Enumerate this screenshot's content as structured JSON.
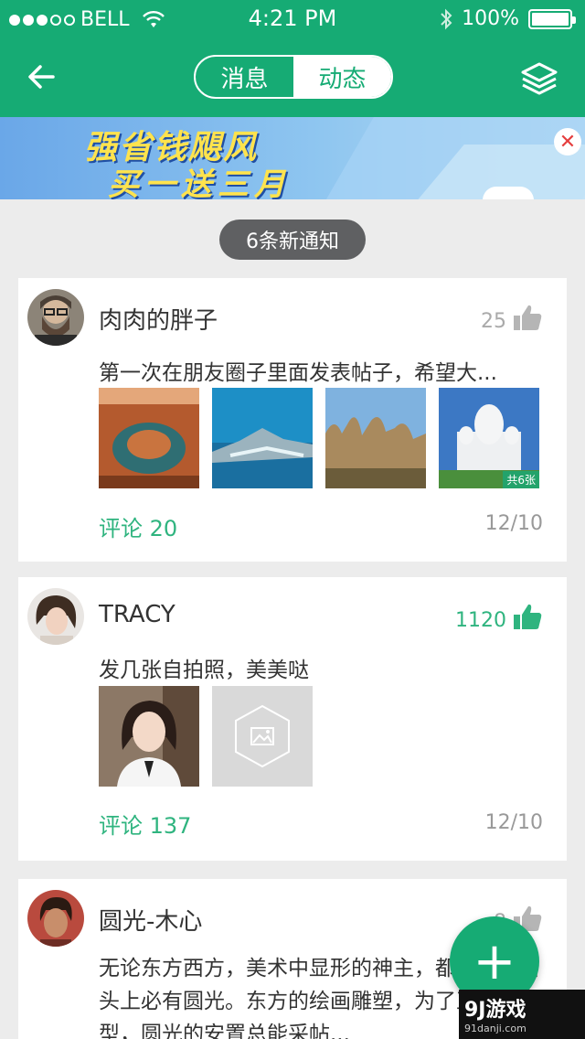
{
  "status": {
    "carrier": "BELL",
    "time": "4:21 PM",
    "battery": "100%"
  },
  "nav": {
    "tabs": [
      "消息",
      "动态"
    ],
    "active_tab": "动态"
  },
  "banner": {
    "headline": "强省钱飓风",
    "subline": "买一送三月"
  },
  "notice": "6条新通知",
  "posts": [
    {
      "user": "肉肉的胖子",
      "likes": "25",
      "text": "第一次在朋友圈子里面发表帖子，希望大...",
      "photo_count_badge": "共6张",
      "comments": "评论 20",
      "date": "12/10"
    },
    {
      "user": "TRACY",
      "likes": "1120",
      "text": "发几张自拍照，美美哒",
      "comments": "评论 137",
      "date": "12/10"
    },
    {
      "user": "圆光-木心",
      "likes": "8",
      "text": "无论东方西方，美术中显形的神主，都有如高僧头上必有圆光。东方的绘画雕塑，为了正面造型，圆光的安置总能采帖..."
    }
  ],
  "fab_label": "+",
  "watermark": {
    "brand": "9J游戏",
    "site": "91danji.com"
  },
  "colors": {
    "primary": "#16ab74",
    "accent_text": "#2fb47f"
  }
}
